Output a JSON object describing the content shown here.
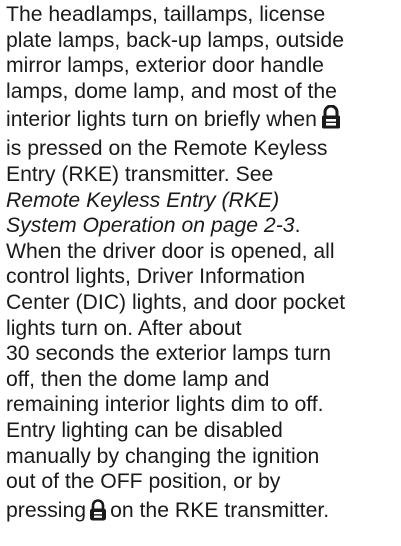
{
  "document": {
    "lines": [
      "The headlamps, taillamps, license",
      "plate lamps, back-up lamps, outside",
      "mirror lamps, exterior door handle",
      "lamps, dome lamp, and most of the"
    ],
    "line5_before_icon": "interior lights turn on briefly when",
    "line6": "is pressed on the Remote Keyless",
    "line7": "Entry (RKE) transmitter. See",
    "xref_line1": "Remote Keyless Entry (RKE)",
    "xref_line2": "System Operation on page 2-3",
    "xref_period": ".",
    "lines_after": [
      "When the driver door is opened, all",
      "control lights, Driver Information",
      "Center (DIC) lights, and door pocket",
      "lights turn on. After about",
      "30 seconds the exterior lamps turn",
      "off, then the dome lamp and",
      "remaining interior lights dim to off.",
      "Entry lighting can be disabled",
      "manually by changing the ignition",
      "out of the OFF position, or by"
    ],
    "last_before_icon": "pressing",
    "last_after_icon": "on the RKE transmitter.",
    "icons": {
      "unlock": "unlock-icon",
      "lock": "lock-icon"
    }
  }
}
